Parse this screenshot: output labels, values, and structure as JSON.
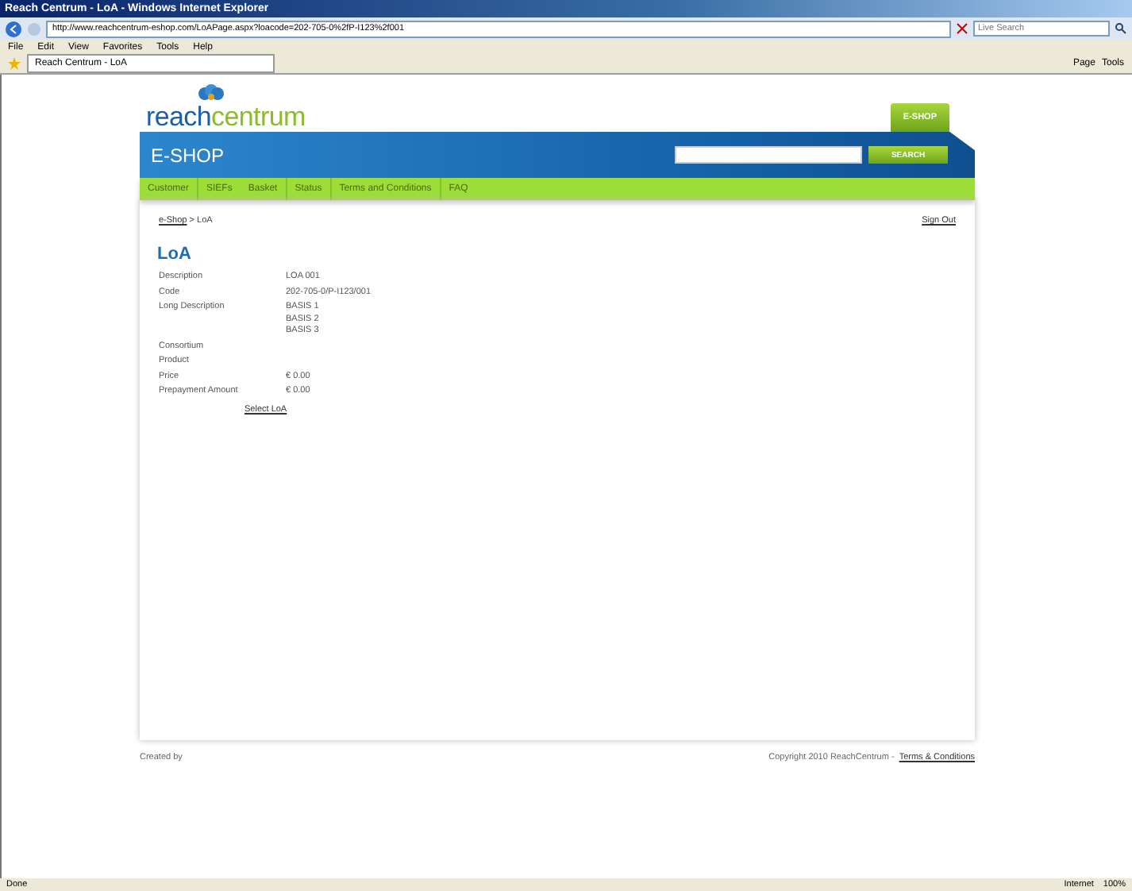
{
  "window": {
    "title": "Reach Centrum - LoA - Windows Internet Explorer"
  },
  "address_bar": {
    "url": "http://www.reachcentrum-eshop.com/LoAPage.aspx?loacode=202-705-0%2fP-I123%2f001",
    "search_placeholder": "Live Search"
  },
  "menu": [
    "File",
    "Edit",
    "View",
    "Favorites",
    "Tools",
    "Help"
  ],
  "browser_tab": {
    "label": "Reach Centrum - LoA"
  },
  "command_bar": [
    "Page",
    "Tools"
  ],
  "site": {
    "logo_left": "reach",
    "logo_right": "centrum",
    "eshop_tab": "E-SHOP",
    "header_title": "E-SHOP",
    "search_button": "SEARCH",
    "nav": [
      "Customer",
      "SIEFs",
      "Basket",
      "Status",
      "Terms and Conditions",
      "FAQ"
    ]
  },
  "breadcrumb": {
    "link": "e-Shop",
    "separator": ">",
    "current": "LoA"
  },
  "sign_out": "Sign Out",
  "heading": "LoA",
  "fields": [
    {
      "label": "Description",
      "values": [
        "LOA 001"
      ]
    },
    {
      "label": "Code",
      "values": [
        "202-705-0/P-I123/001"
      ]
    },
    {
      "label": "Long Description",
      "values": [
        "BASIS 1",
        "BASIS 2",
        "BASIS 3"
      ]
    },
    {
      "label": "Consortium"
    },
    {
      "label": "Product"
    },
    {
      "label": "Price",
      "values": [
        "€ 0.00"
      ]
    },
    {
      "label": "Prepayment Amount",
      "values": [
        "€ 0.00"
      ]
    }
  ],
  "select_link": "Select LoA",
  "footer": {
    "created": "Created by",
    "copyright": "Copyright 2010 ReachCentrum -",
    "terms": "Terms & Conditions"
  },
  "status_bar": {
    "status": "Done",
    "zone": "Internet",
    "zoom": "100%"
  }
}
